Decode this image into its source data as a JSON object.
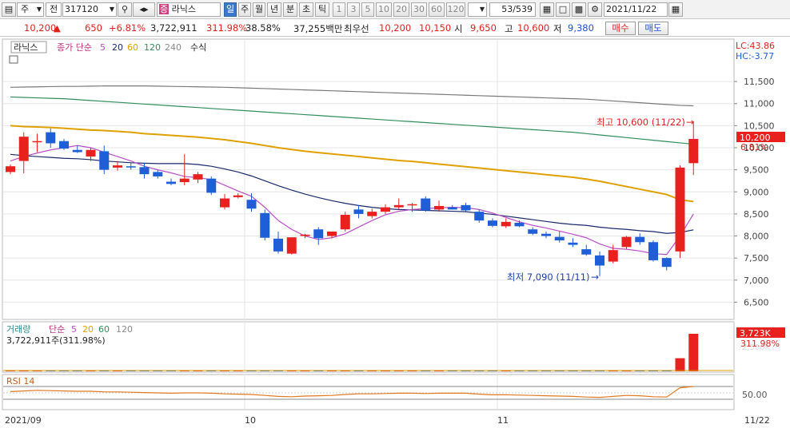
{
  "toolbar": {
    "mode_label": "주",
    "all_label": "전",
    "code": "317120",
    "stock_name": "라닉스",
    "stock_badge": "증",
    "periods": [
      "일",
      "주",
      "월",
      "년",
      "분",
      "초",
      "틱"
    ],
    "intervals": [
      "1",
      "3",
      "5",
      "10",
      "20",
      "30",
      "60",
      "120"
    ],
    "page_counter": "53/539",
    "date": "2021/11/22"
  },
  "price": {
    "current": "10,200",
    "arrow": "▲",
    "change": "650",
    "pct": "+6.81%",
    "volume": "3,722,911",
    "vol_ratio": "311.98%",
    "turnover": "38.58%",
    "amount": "37,255백만",
    "best_label": "최우선",
    "best_ask": "10,200",
    "best_bid": "10,150",
    "open_label": "시",
    "open": "9,650",
    "high_label": "고",
    "high": "10,600",
    "low_label": "저",
    "low": "9,380",
    "buy_label": "매수",
    "sell_label": "매도"
  },
  "legend": {
    "name": "라닉스",
    "ma_label": "종가 단순",
    "ma_periods": [
      "5",
      "20",
      "60",
      "120",
      "240"
    ],
    "formula": "수식",
    "lc": "LC:43.86",
    "hc": "HC:-3.77"
  },
  "annotations": {
    "high": "최고 10,600 (11/22)",
    "low": "최저 7,090 (11/11)"
  },
  "price_tags": {
    "price": "10,200",
    "pct": "6.81%"
  },
  "volume_panel": {
    "label": "거래량",
    "ma_label": "단순",
    "periods": [
      "5",
      "20",
      "60",
      "120"
    ],
    "info": "3,722,911주(311.98%)",
    "tag": "3,723K",
    "tag_pct": "311.98%",
    "axis_cut": "2,500K"
  },
  "rsi_panel": {
    "label": "RSI 14",
    "level": "50.00"
  },
  "dates": {
    "start": "2021/09",
    "oct": "10",
    "nov": "11",
    "end": "11/22"
  },
  "colors": {
    "up": "#e8201e",
    "down": "#1e5ed6",
    "ma5": "#b94fc8",
    "ma20": "#1a2a6c",
    "ma60": "#e0a000",
    "ma120": "#2f8f5a",
    "ma240": "#7a7a7a"
  },
  "chart_data": {
    "type": "candlestick",
    "y_ticks": [
      11500,
      11000,
      10500,
      10000,
      9500,
      9000,
      8500,
      8000,
      7500,
      7000,
      6500
    ],
    "ylim": [
      6200,
      11900
    ],
    "candles": [
      {
        "o": 9450,
        "h": 9620,
        "l": 9400,
        "c": 9580
      },
      {
        "o": 9700,
        "h": 10350,
        "l": 9420,
        "c": 10250
      },
      {
        "o": 10150,
        "h": 10320,
        "l": 9900,
        "c": 10150
      },
      {
        "o": 10350,
        "h": 10440,
        "l": 10000,
        "c": 10100
      },
      {
        "o": 10150,
        "h": 10200,
        "l": 9950,
        "c": 9980
      },
      {
        "o": 9950,
        "h": 10050,
        "l": 9880,
        "c": 9900
      },
      {
        "o": 9800,
        "h": 10000,
        "l": 9700,
        "c": 9950
      },
      {
        "o": 9920,
        "h": 10050,
        "l": 9400,
        "c": 9500
      },
      {
        "o": 9550,
        "h": 9700,
        "l": 9480,
        "c": 9600
      },
      {
        "o": 9580,
        "h": 9650,
        "l": 9500,
        "c": 9560
      },
      {
        "o": 9560,
        "h": 9650,
        "l": 9300,
        "c": 9400
      },
      {
        "o": 9450,
        "h": 9500,
        "l": 9300,
        "c": 9350
      },
      {
        "o": 9230,
        "h": 9300,
        "l": 9150,
        "c": 9180
      },
      {
        "o": 9220,
        "h": 9850,
        "l": 9150,
        "c": 9300
      },
      {
        "o": 9280,
        "h": 9450,
        "l": 9200,
        "c": 9400
      },
      {
        "o": 9300,
        "h": 9350,
        "l": 8930,
        "c": 8980
      },
      {
        "o": 8650,
        "h": 8950,
        "l": 8600,
        "c": 8850
      },
      {
        "o": 8880,
        "h": 8970,
        "l": 8850,
        "c": 8920
      },
      {
        "o": 8820,
        "h": 8970,
        "l": 8550,
        "c": 8620
      },
      {
        "o": 8520,
        "h": 8600,
        "l": 7900,
        "c": 7960
      },
      {
        "o": 7940,
        "h": 8100,
        "l": 7600,
        "c": 7650
      },
      {
        "o": 7600,
        "h": 7950,
        "l": 7580,
        "c": 7970
      },
      {
        "o": 8000,
        "h": 8050,
        "l": 7950,
        "c": 8030
      },
      {
        "o": 8150,
        "h": 8200,
        "l": 7800,
        "c": 7950
      },
      {
        "o": 8000,
        "h": 8100,
        "l": 7950,
        "c": 8100
      },
      {
        "o": 8150,
        "h": 8550,
        "l": 8100,
        "c": 8480
      },
      {
        "o": 8600,
        "h": 8700,
        "l": 8400,
        "c": 8500
      },
      {
        "o": 8450,
        "h": 8620,
        "l": 8400,
        "c": 8550
      },
      {
        "o": 8550,
        "h": 8720,
        "l": 8500,
        "c": 8650
      },
      {
        "o": 8650,
        "h": 8850,
        "l": 8600,
        "c": 8700
      },
      {
        "o": 8700,
        "h": 8750,
        "l": 8550,
        "c": 8720
      },
      {
        "o": 8850,
        "h": 8900,
        "l": 8550,
        "c": 8580
      },
      {
        "o": 8600,
        "h": 8800,
        "l": 8550,
        "c": 8680
      },
      {
        "o": 8650,
        "h": 8700,
        "l": 8600,
        "c": 8600
      },
      {
        "o": 8700,
        "h": 8750,
        "l": 8550,
        "c": 8580
      },
      {
        "o": 8550,
        "h": 8600,
        "l": 8300,
        "c": 8350
      },
      {
        "o": 8350,
        "h": 8400,
        "l": 8200,
        "c": 8230
      },
      {
        "o": 8220,
        "h": 8400,
        "l": 8180,
        "c": 8320
      },
      {
        "o": 8300,
        "h": 8350,
        "l": 8200,
        "c": 8220
      },
      {
        "o": 8150,
        "h": 8200,
        "l": 8020,
        "c": 8050
      },
      {
        "o": 8050,
        "h": 8100,
        "l": 7950,
        "c": 8000
      },
      {
        "o": 7980,
        "h": 8100,
        "l": 7850,
        "c": 7900
      },
      {
        "o": 7850,
        "h": 7950,
        "l": 7750,
        "c": 7800
      },
      {
        "o": 7700,
        "h": 7800,
        "l": 7550,
        "c": 7580
      },
      {
        "o": 7560,
        "h": 7650,
        "l": 7090,
        "c": 7330
      },
      {
        "o": 7420,
        "h": 7800,
        "l": 7380,
        "c": 7680
      },
      {
        "o": 7750,
        "h": 8000,
        "l": 7700,
        "c": 7980
      },
      {
        "o": 7980,
        "h": 8060,
        "l": 7800,
        "c": 7860
      },
      {
        "o": 7860,
        "h": 7900,
        "l": 7420,
        "c": 7450
      },
      {
        "o": 7500,
        "h": 7520,
        "l": 7220,
        "c": 7300
      },
      {
        "o": 7650,
        "h": 9600,
        "l": 7500,
        "c": 9550
      },
      {
        "o": 9650,
        "h": 10600,
        "l": 9380,
        "c": 10200
      }
    ],
    "ma5": [
      9700,
      9800,
      9880,
      9950,
      10000,
      10050,
      10000,
      9900,
      9800,
      9700,
      9580,
      9500,
      9430,
      9350,
      9320,
      9280,
      9150,
      9020,
      8900,
      8650,
      8350,
      8150,
      8000,
      7920,
      7960,
      8050,
      8200,
      8350,
      8480,
      8560,
      8600,
      8620,
      8640,
      8650,
      8640,
      8600,
      8520,
      8420,
      8320,
      8240,
      8180,
      8110,
      8040,
      7960,
      7820,
      7720,
      7700,
      7660,
      7600,
      7580,
      8000,
      8500
    ],
    "ma20": [
      9850,
      9820,
      9800,
      9780,
      9760,
      9750,
      9730,
      9700,
      9680,
      9660,
      9650,
      9640,
      9640,
      9640,
      9620,
      9580,
      9520,
      9450,
      9360,
      9250,
      9140,
      9040,
      8950,
      8870,
      8800,
      8740,
      8690,
      8650,
      8620,
      8600,
      8590,
      8580,
      8570,
      8560,
      8550,
      8520,
      8490,
      8450,
      8410,
      8370,
      8330,
      8290,
      8260,
      8240,
      8200,
      8170,
      8150,
      8120,
      8100,
      8060,
      8080,
      8140
    ],
    "ma60": [
      10500,
      10480,
      10470,
      10460,
      10440,
      10420,
      10400,
      10390,
      10370,
      10350,
      10320,
      10300,
      10280,
      10260,
      10240,
      10210,
      10180,
      10140,
      10100,
      10050,
      10000,
      9960,
      9920,
      9890,
      9860,
      9830,
      9800,
      9770,
      9740,
      9710,
      9690,
      9660,
      9630,
      9600,
      9570,
      9540,
      9510,
      9480,
      9450,
      9420,
      9390,
      9360,
      9330,
      9290,
      9240,
      9180,
      9120,
      9060,
      9000,
      8940,
      8820,
      8780
    ],
    "ma120": [
      11150,
      11140,
      11130,
      11120,
      11110,
      11090,
      11070,
      11050,
      11030,
      11010,
      10990,
      10970,
      10950,
      10930,
      10910,
      10890,
      10870,
      10850,
      10830,
      10810,
      10790,
      10770,
      10750,
      10730,
      10710,
      10690,
      10670,
      10650,
      10630,
      10610,
      10590,
      10570,
      10550,
      10530,
      10510,
      10490,
      10470,
      10450,
      10430,
      10410,
      10390,
      10370,
      10350,
      10320,
      10290,
      10260,
      10230,
      10200,
      10170,
      10140,
      10110,
      10080
    ],
    "ma240": [
      11370,
      11375,
      11380,
      11385,
      11390,
      11390,
      11395,
      11400,
      11400,
      11400,
      11400,
      11395,
      11390,
      11385,
      11380,
      11375,
      11370,
      11360,
      11350,
      11340,
      11330,
      11320,
      11310,
      11300,
      11290,
      11280,
      11270,
      11260,
      11250,
      11240,
      11230,
      11220,
      11210,
      11200,
      11190,
      11180,
      11170,
      11160,
      11150,
      11140,
      11130,
      11120,
      11110,
      11100,
      11080,
      11060,
      11040,
      11020,
      11000,
      10980,
      10960,
      10950
    ],
    "volume": [
      40,
      90,
      60,
      50,
      35,
      30,
      35,
      55,
      30,
      25,
      40,
      30,
      25,
      60,
      30,
      40,
      35,
      25,
      45,
      80,
      60,
      40,
      20,
      45,
      25,
      60,
      35,
      30,
      30,
      30,
      25,
      40,
      30,
      20,
      20,
      35,
      30,
      25,
      20,
      25,
      20,
      20,
      25,
      30,
      60,
      35,
      40,
      30,
      40,
      35,
      1300,
      3723
    ],
    "rsi": [
      54,
      56,
      58,
      57,
      56,
      55,
      55,
      53,
      53,
      52,
      51,
      50,
      49,
      50,
      50,
      49,
      47,
      46,
      45,
      42,
      39,
      38,
      40,
      41,
      42,
      45,
      47,
      47,
      48,
      49,
      49,
      48,
      49,
      49,
      49,
      46,
      44,
      44,
      43,
      42,
      41,
      40,
      39,
      37,
      36,
      39,
      42,
      41,
      38,
      37,
      66,
      70
    ]
  }
}
